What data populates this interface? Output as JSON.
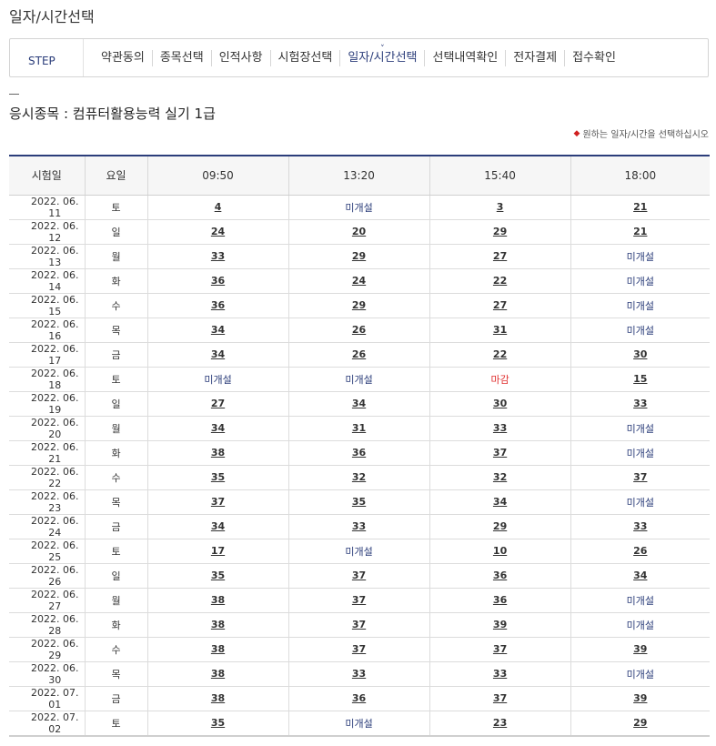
{
  "page_title": "일자/시간선택",
  "step_bar": {
    "label": "STEP",
    "steps": [
      "약관동의",
      "종목선택",
      "인적사항",
      "시험장선택",
      "일자/시간선택",
      "선택내역확인",
      "전자결제",
      "접수확인"
    ],
    "active_index": 4
  },
  "subject": "응시종목 : 컴퓨터활용능력 실기 1급",
  "notice": "원하는 일자/시간을 선택하십시오",
  "table": {
    "headers": [
      "시험일",
      "요일",
      "09:50",
      "13:20",
      "15:40",
      "18:00"
    ],
    "rows": [
      {
        "date": "2022. 06. 11",
        "day": "토",
        "slots": [
          "4",
          "미개설",
          "3",
          "21"
        ]
      },
      {
        "date": "2022. 06. 12",
        "day": "일",
        "slots": [
          "24",
          "20",
          "29",
          "21"
        ]
      },
      {
        "date": "2022. 06. 13",
        "day": "월",
        "slots": [
          "33",
          "29",
          "27",
          "미개설"
        ]
      },
      {
        "date": "2022. 06. 14",
        "day": "화",
        "slots": [
          "36",
          "24",
          "22",
          "미개설"
        ]
      },
      {
        "date": "2022. 06. 15",
        "day": "수",
        "slots": [
          "36",
          "29",
          "27",
          "미개설"
        ]
      },
      {
        "date": "2022. 06. 16",
        "day": "목",
        "slots": [
          "34",
          "26",
          "31",
          "미개설"
        ]
      },
      {
        "date": "2022. 06. 17",
        "day": "금",
        "slots": [
          "34",
          "26",
          "22",
          "30"
        ]
      },
      {
        "date": "2022. 06. 18",
        "day": "토",
        "slots": [
          "미개설",
          "미개설",
          "마감",
          "15"
        ]
      },
      {
        "date": "2022. 06. 19",
        "day": "일",
        "slots": [
          "27",
          "34",
          "30",
          "33"
        ]
      },
      {
        "date": "2022. 06. 20",
        "day": "월",
        "slots": [
          "34",
          "31",
          "33",
          "미개설"
        ]
      },
      {
        "date": "2022. 06. 21",
        "day": "화",
        "slots": [
          "38",
          "36",
          "37",
          "미개설"
        ]
      },
      {
        "date": "2022. 06. 22",
        "day": "수",
        "slots": [
          "35",
          "32",
          "32",
          "37"
        ]
      },
      {
        "date": "2022. 06. 23",
        "day": "목",
        "slots": [
          "37",
          "35",
          "34",
          "미개설"
        ]
      },
      {
        "date": "2022. 06. 24",
        "day": "금",
        "slots": [
          "34",
          "33",
          "29",
          "33"
        ]
      },
      {
        "date": "2022. 06. 25",
        "day": "토",
        "slots": [
          "17",
          "미개설",
          "10",
          "26"
        ]
      },
      {
        "date": "2022. 06. 26",
        "day": "일",
        "slots": [
          "35",
          "37",
          "36",
          "34"
        ]
      },
      {
        "date": "2022. 06. 27",
        "day": "월",
        "slots": [
          "38",
          "37",
          "36",
          "미개설"
        ]
      },
      {
        "date": "2022. 06. 28",
        "day": "화",
        "slots": [
          "38",
          "37",
          "39",
          "미개설"
        ]
      },
      {
        "date": "2022. 06. 29",
        "day": "수",
        "slots": [
          "38",
          "37",
          "37",
          "39"
        ]
      },
      {
        "date": "2022. 06. 30",
        "day": "목",
        "slots": [
          "38",
          "33",
          "33",
          "미개설"
        ]
      },
      {
        "date": "2022. 07. 01",
        "day": "금",
        "slots": [
          "38",
          "36",
          "37",
          "39"
        ]
      },
      {
        "date": "2022. 07. 02",
        "day": "토",
        "slots": [
          "35",
          "미개설",
          "23",
          "29"
        ]
      }
    ]
  },
  "colors": {
    "accent": "#2b3d7a",
    "closed": "#e03030",
    "header_bg": "#f6f6f6",
    "notice_bullet": "#d02020"
  },
  "icons": {
    "notice_bullet": "diamond-bullet-icon",
    "active_step_marker": "chevron-down-icon"
  }
}
